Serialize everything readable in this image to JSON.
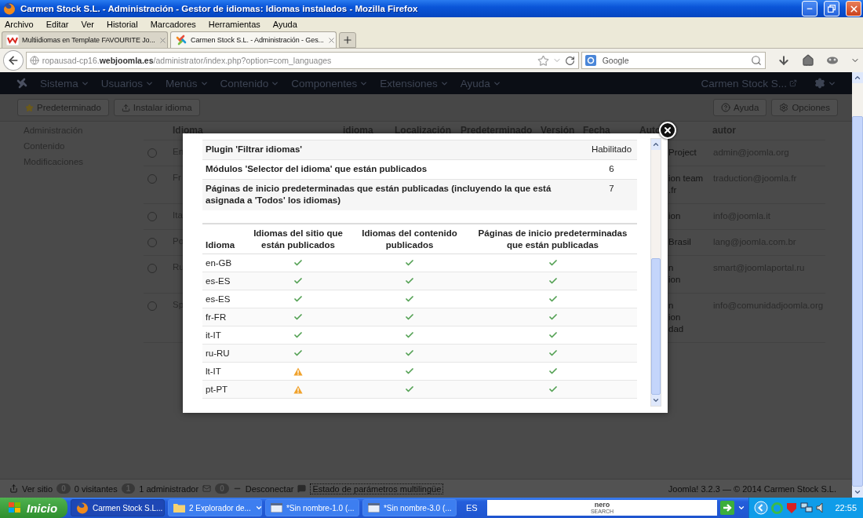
{
  "browser": {
    "title": "Carmen Stock S.L. - Administración - Gestor de idiomas: Idiomas instalados - Mozilla Firefox",
    "menu": [
      "Archivo",
      "Editar",
      "Ver",
      "Historial",
      "Marcadores",
      "Herramientas",
      "Ayuda"
    ],
    "tabs": [
      {
        "label": "Multiidiomas en Template FAVOURITE Jo...",
        "kind": "blog",
        "selected": false
      },
      {
        "label": "Carmen Stock S.L. - Administración - Ges...",
        "kind": "joomla",
        "selected": true
      }
    ],
    "url": "ropausad-cp16.**webjoomla.es**/administrator/index.php?option=com_languages",
    "search": {
      "placeholder": "Google"
    }
  },
  "admin_nav": {
    "items": [
      "Sistema",
      "Usuarios",
      "Menús",
      "Contenido",
      "Componentes",
      "Extensiones",
      "Ayuda"
    ],
    "site_name": "Carmen Stock S..."
  },
  "toolbar": {
    "left": [
      {
        "label": "Predeterminado",
        "kind": "star"
      },
      {
        "label": "Instalar idioma",
        "kind": "upload"
      }
    ],
    "right": [
      {
        "label": "Ayuda",
        "kind": "help"
      },
      {
        "label": "Opciones",
        "kind": "gear"
      }
    ]
  },
  "sidebar": {
    "items": [
      "Administración",
      "Contenido",
      "Modificaciones"
    ]
  },
  "languages_table": {
    "columns": [
      "Idioma",
      "idioma",
      "Localización",
      "Predeterminado",
      "Versión",
      "Fecha",
      "Auto",
      "autor"
    ],
    "rows": [
      {
        "name": "En",
        "selected": false,
        "author": [
          "Project"
        ],
        "email": "admin@joomla.org"
      },
      {
        "name": "Fr",
        "selected": false,
        "author": [
          "ion team",
          ".fr"
        ],
        "email": "traduction@joomla.fr"
      },
      {
        "name": "Ita",
        "selected": false,
        "author": [
          "ion"
        ],
        "email": "info@joomla.it"
      },
      {
        "name": "Po",
        "selected": false,
        "author": [
          "Brasil"
        ],
        "email": "lang@joomla.com.br"
      },
      {
        "name": "Ru",
        "selected": false,
        "author": [
          "n",
          "ion"
        ],
        "email": "smart@joomlaportal.ru"
      },
      {
        "name": "Sp",
        "selected": false,
        "author": [
          "n",
          "ion",
          "dad"
        ],
        "email": "info@comunidadjoomla.org"
      }
    ]
  },
  "modal": {
    "info_rows": [
      {
        "label": "Plugin 'Filtrar idiomas'",
        "value": "Habilitado"
      },
      {
        "label": "Módulos 'Selector del idioma' que están publicados",
        "value": "6"
      },
      {
        "label": "Páginas de inicio predeterminadas que están publicadas (incluyendo la que está asignada a 'Todos' los idiomas)",
        "value": "7"
      }
    ],
    "status_table": {
      "columns": [
        "Idioma",
        "Idiomas del sitio que están publicados",
        "Idiomas del contenido publicados",
        "Páginas de inicio predeterminadas que están publicadas"
      ],
      "rows": [
        {
          "code": "en-GB",
          "site_published": true,
          "content_published": true,
          "home_published": true
        },
        {
          "code": "es-ES",
          "site_published": true,
          "content_published": true,
          "home_published": true
        },
        {
          "code": "es-ES",
          "site_published": true,
          "content_published": true,
          "home_published": true
        },
        {
          "code": "fr-FR",
          "site_published": true,
          "content_published": true,
          "home_published": true
        },
        {
          "code": "it-IT",
          "site_published": true,
          "content_published": true,
          "home_published": true
        },
        {
          "code": "ru-RU",
          "site_published": true,
          "content_published": true,
          "home_published": true
        },
        {
          "code": "lt-IT",
          "site_published": false,
          "content_published": true,
          "home_published": true
        },
        {
          "code": "pt-PT",
          "site_published": false,
          "content_published": true,
          "home_published": true
        }
      ]
    }
  },
  "status_bar": {
    "view_site": "Ver sitio",
    "visitors_count": "0",
    "visitors": "0 visitantes",
    "admins_count": "1",
    "admins": "1 administrador",
    "messages_count": "0",
    "logout": "Desconectar",
    "multilingual_status": "Estado de parámetros multilingüe",
    "footer": "Joomla! 3.2.3 — © 2014 Carmen Stock S.L."
  },
  "taskbar": {
    "start": "Inicio",
    "tasks": [
      {
        "label": "Carmen Stock S.L...",
        "kind": "firefox",
        "selected": true
      },
      {
        "label": "2 Explorador de...",
        "kind": "folder",
        "selected": false
      },
      {
        "label": "*Sin nombre-1.0 (...",
        "kind": "paint",
        "selected": false
      },
      {
        "label": "*Sin nombre-3.0 (...",
        "kind": "paint",
        "selected": false
      }
    ],
    "language": "ES",
    "search_logo": [
      "nero",
      "SEARCH"
    ],
    "clock": "22:55"
  }
}
